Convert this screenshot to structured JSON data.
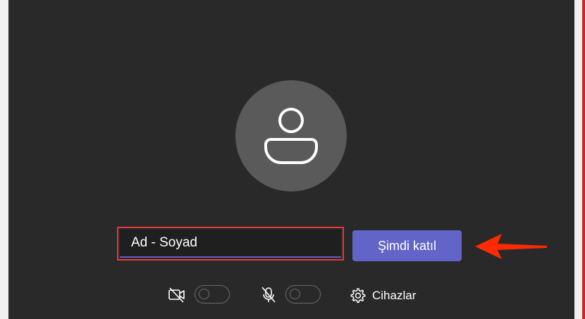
{
  "prejoin": {
    "avatar_icon": "person-icon",
    "name_input": {
      "value": "Ad - Soyad",
      "placeholder": ""
    },
    "join_button_label": "Şimdi katıl"
  },
  "controls": {
    "camera": {
      "icon": "camera-off-icon",
      "enabled": false
    },
    "microphone": {
      "icon": "mic-off-icon",
      "enabled": false
    },
    "devices": {
      "icon": "gear-icon",
      "label": "Cihazlar"
    }
  },
  "annotations": {
    "highlight_color": "#e53935",
    "arrow_color": "#ff2a00"
  },
  "colors": {
    "background": "#292929",
    "avatar": "#5a5a5a",
    "accent": "#6264c8"
  }
}
